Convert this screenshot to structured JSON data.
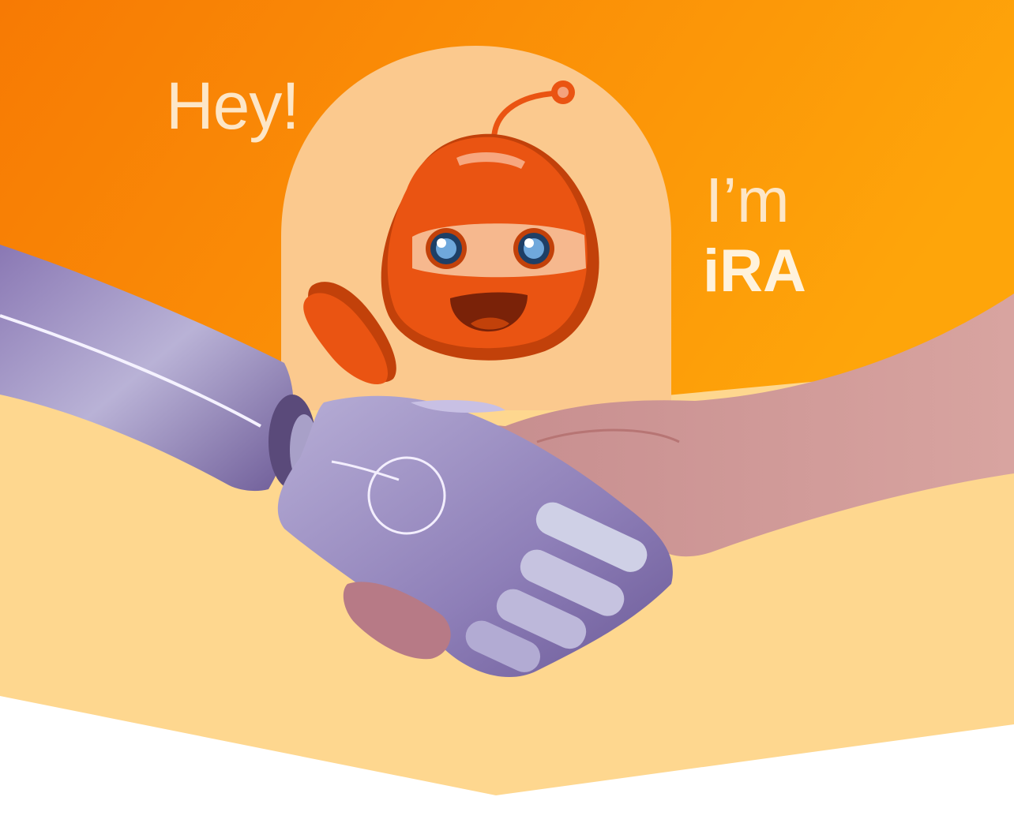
{
  "greeting": {
    "hey": "Hey!",
    "im": "I’m",
    "name": "iRA"
  },
  "colors": {
    "orange_dark": "#f77a04",
    "orange_light": "#fea50a",
    "peach_band": "#fed78f",
    "bubble": "#fbc98e",
    "mascot": "#ea5412",
    "text_cream": "#fde6c7"
  },
  "icons": {
    "mascot": "robot-mascot-icon",
    "handshake": "robot-human-handshake-icon"
  }
}
